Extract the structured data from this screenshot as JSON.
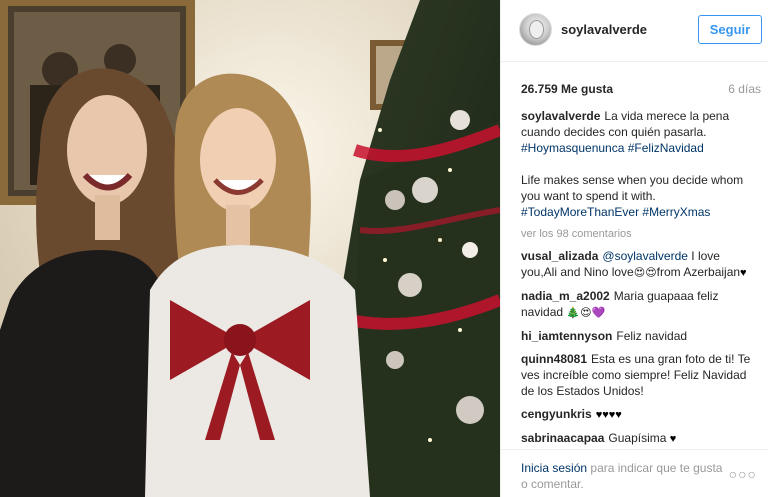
{
  "post": {
    "username": "soylavalverde",
    "follow_label": "Seguir",
    "likes": "26.759 Me gusta",
    "time_ago": "6 días",
    "caption_user": "soylavalverde",
    "caption_es": "La vida merece la pena cuando decides con quién pasarla.",
    "caption_es_tags": "#Hoymasquenunca #FelizNavidad",
    "caption_en": "Life makes sense when you decide whom you want to spend it with.",
    "caption_en_tags": "#TodayMoreThanEver #MerryXmas",
    "view_more": "ver los 98 comentarios"
  },
  "comments": [
    {
      "user": "vusal_alizada",
      "mention": "@soylavalverde",
      "text": "I love you,Ali and Nino love",
      "emoji": "😍😍",
      "text2": "from Azerbaijan",
      "heart": "♥"
    },
    {
      "user": "nadia_m_a2002",
      "text": "Maria guapaaa feliz navidad",
      "emoji": "🎄😍💜"
    },
    {
      "user": "hi_iamtennyson",
      "text": "Feliz navidad"
    },
    {
      "user": "quinn48081",
      "text": "Esta es una gran foto de ti! Te ves increíble como siempre! Feliz Navidad de los Estados Unidos!"
    },
    {
      "user": "cengyunkris",
      "heart": "♥♥♥♥"
    },
    {
      "user": "sabrinaacapaa",
      "text": "Guapísima",
      "heart": "♥"
    }
  ],
  "footer": {
    "login_link": "Inicia sesión",
    "login_rest": "para indicar que te gusta o comentar.",
    "more_options": "○○○"
  },
  "colors": {
    "accent": "#3897f0",
    "link": "#003569",
    "muted": "#999999"
  }
}
